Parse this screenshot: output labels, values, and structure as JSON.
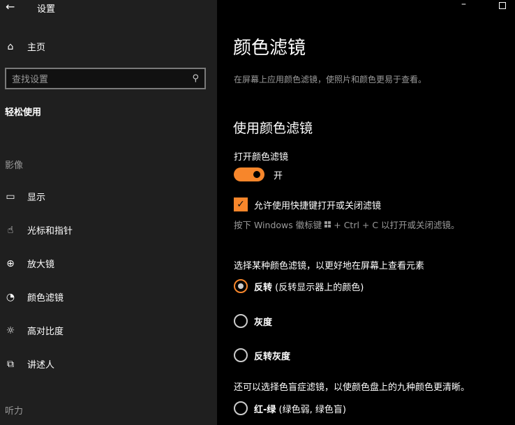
{
  "window": {
    "title": "设置",
    "back_icon": "arrow-left",
    "minimize_icon": "minimize",
    "maximize_icon": "maximize"
  },
  "sidebar": {
    "home": "主页",
    "search_placeholder": "查找设置",
    "category": "轻松使用",
    "sections": [
      {
        "title": "影像",
        "items": [
          {
            "label": "显示",
            "icon": "monitor"
          },
          {
            "label": "光标和指针",
            "icon": "pointer"
          },
          {
            "label": "放大镜",
            "icon": "magnifier"
          },
          {
            "label": "颜色滤镜",
            "icon": "palette"
          },
          {
            "label": "高对比度",
            "icon": "sun"
          },
          {
            "label": "讲述人",
            "icon": "narrator"
          }
        ]
      },
      {
        "title": "听力",
        "items": []
      }
    ]
  },
  "main": {
    "title": "颜色滤镜",
    "subtitle": "在屏幕上应用颜色滤镜，使照片和颜色更易于查看。",
    "section_title": "使用颜色滤镜",
    "toggle_label": "打开颜色滤镜",
    "toggle_state": "开",
    "shortcut_checkbox": "允许使用快捷键打开或关闭滤镜",
    "shortcut_hint_pre": "按下 Windows 徽标键",
    "shortcut_hint_post": "+ Ctrl + C 以打开或关闭滤镜。",
    "filter_prompt": "选择某种颜色滤镜，以更好地在屏幕上查看元素",
    "filters": [
      {
        "name": "反转",
        "desc": "(反转显示器上的颜色)",
        "selected": true
      },
      {
        "name": "灰度",
        "desc": "",
        "selected": false
      },
      {
        "name": "反转灰度",
        "desc": "",
        "selected": false
      }
    ],
    "colorblind_prompt": "还可以选择色盲症滤镜，以使颜色盘上的九种颜色更清晰。",
    "colorblind_filters": [
      {
        "name": "红-绿",
        "desc": "(绿色弱, 绿色盲)",
        "selected": false
      }
    ]
  },
  "colors": {
    "accent": "#f7862b",
    "sidebar_bg": "#1f1f1f",
    "main_bg": "#000000"
  }
}
